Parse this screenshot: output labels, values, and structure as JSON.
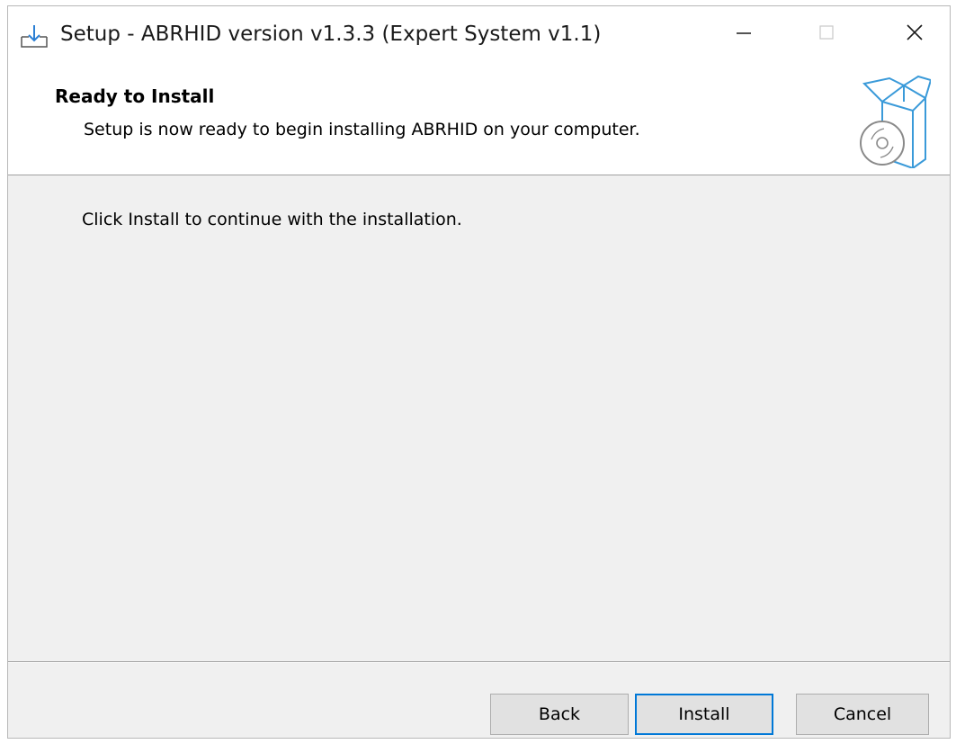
{
  "window": {
    "title": "Setup - ABRHID version v1.3.3 (Expert System v1.1)"
  },
  "header": {
    "title": "Ready to Install",
    "subtitle": "Setup is now ready to begin installing ABRHID on your computer."
  },
  "body": {
    "message": "Click Install to continue with the installation."
  },
  "buttons": {
    "back": "Back",
    "install": "Install",
    "cancel": "Cancel"
  },
  "icons": {
    "app": "installer-download-icon",
    "header": "software-box-disc-icon",
    "minimize": "minimize-icon",
    "maximize": "maximize-icon",
    "close": "close-icon"
  },
  "colors": {
    "accent": "#0078d7",
    "window_bg": "#f0f0f0",
    "header_bg": "#ffffff",
    "button_bg": "#e1e1e1"
  }
}
